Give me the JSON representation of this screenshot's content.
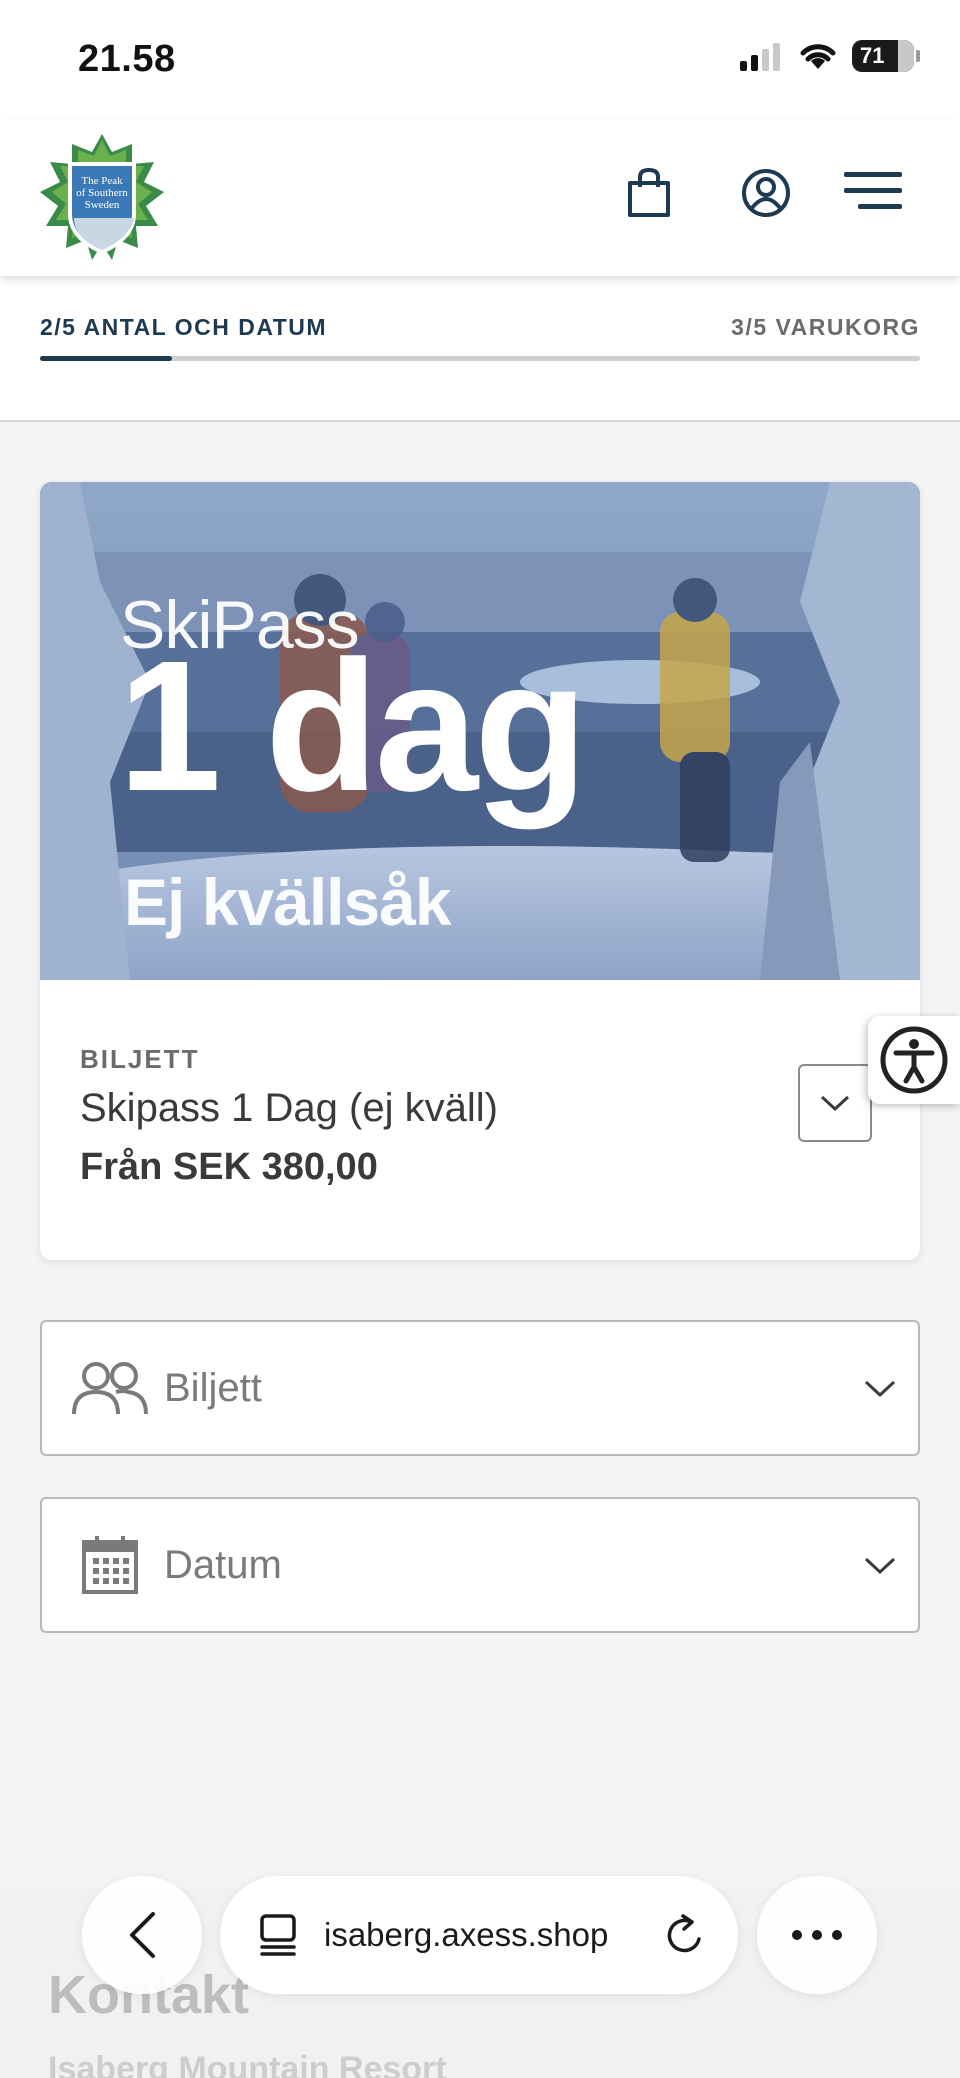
{
  "status_bar": {
    "time": "21.58",
    "battery": "71"
  },
  "header": {
    "logo_text_line1": "The Peak",
    "logo_text_line2": "of Southern",
    "logo_text_line3": "Sweden"
  },
  "steps": {
    "current_label": "2/5 ANTAL OCH DATUM",
    "next_label": "3/5 VARUKORG",
    "progress_fraction": 0.15
  },
  "product": {
    "image_title_small": "SkiPass",
    "image_title_big": "1 dag",
    "image_title_sub": "Ej kvällsåk",
    "kind": "BILJETT",
    "name": "Skipass 1 Dag (ej kväll)",
    "price": "Från SEK 380,00"
  },
  "selects": {
    "ticket_label": "Biljett",
    "date_label": "Datum"
  },
  "footer": {
    "title": "Kontakt",
    "subtitle": "Isaberg Mountain Resort"
  },
  "browser": {
    "url": "isaberg.axess.shop"
  },
  "colors": {
    "brand_navy": "#1e3a52",
    "background": "#f4f4f5"
  }
}
